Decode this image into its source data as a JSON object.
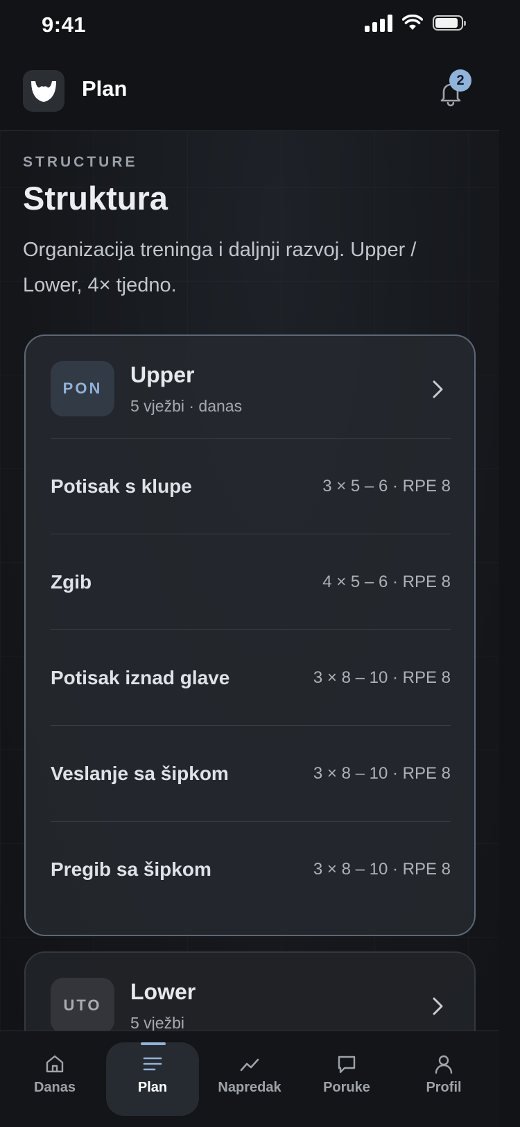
{
  "status_bar": {
    "time": "9:41"
  },
  "header": {
    "title": "Plan",
    "notification_count": "2"
  },
  "section": {
    "eyebrow": "STRUCTURE",
    "title": "Struktura",
    "description": "Organizacija treninga i daljnji razvoj. Upper / Lower, 4× tjedno."
  },
  "days": [
    {
      "day": "PON",
      "title": "Upper",
      "subtitle": "5 vježbi · danas",
      "exercises": [
        {
          "name": "Potisak s klupe",
          "sets": "3 × 5 – 6 · RPE 8"
        },
        {
          "name": "Zgib",
          "sets": "4 × 5 – 6 · RPE 8"
        },
        {
          "name": "Potisak iznad glave",
          "sets": "3 × 8 – 10 · RPE 8"
        },
        {
          "name": "Veslanje sa šipkom",
          "sets": "3 × 8 – 10 · RPE 8"
        },
        {
          "name": "Pregib sa šipkom",
          "sets": "3 × 8 – 10 · RPE 8"
        }
      ]
    },
    {
      "day": "UTO",
      "title": "Lower",
      "subtitle": "5 vježbi"
    }
  ],
  "tabs": [
    {
      "label": "Danas",
      "icon": "home-icon"
    },
    {
      "label": "Plan",
      "icon": "list-icon",
      "active": true
    },
    {
      "label": "Napredak",
      "icon": "trend-icon"
    },
    {
      "label": "Poruke",
      "icon": "chat-icon"
    },
    {
      "label": "Profil",
      "icon": "user-icon"
    }
  ],
  "colors": {
    "accent": "#8fb3d9",
    "background": "#121317",
    "card": "#26292f"
  }
}
